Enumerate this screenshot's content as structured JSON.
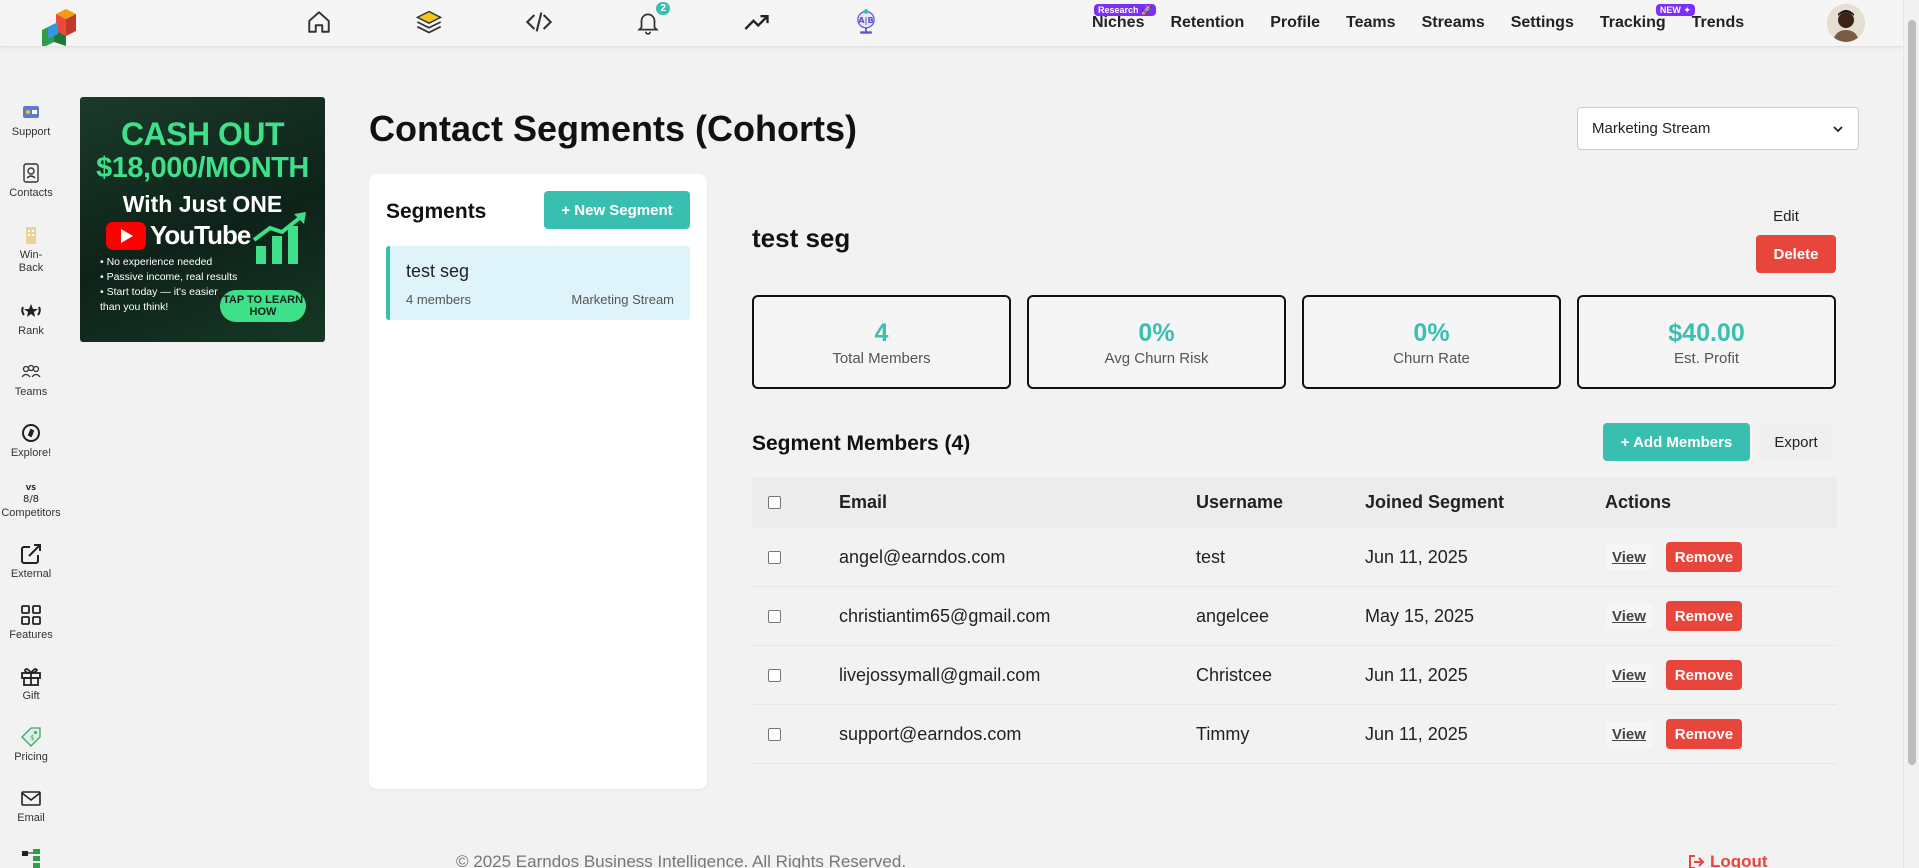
{
  "topbar": {
    "notification_count": "2",
    "nav": [
      {
        "label": "Niches",
        "badge": "Research 🚀"
      },
      {
        "label": "Retention"
      },
      {
        "label": "Profile"
      },
      {
        "label": "Teams"
      },
      {
        "label": "Streams"
      },
      {
        "label": "Settings"
      },
      {
        "label": "Tracking",
        "badge": "NEW ✦"
      },
      {
        "label": "Trends"
      }
    ]
  },
  "sidebar": {
    "items": [
      {
        "label": "Support",
        "icon": "support-icon"
      },
      {
        "label": "Contacts",
        "icon": "contacts-icon"
      },
      {
        "label": "Win-\nBack",
        "icon": "win-back-icon"
      },
      {
        "label": "Rank",
        "icon": "rank-icon"
      },
      {
        "label": "Teams",
        "icon": "teams-icon"
      },
      {
        "label": "Explore!",
        "icon": "compass-icon"
      },
      {
        "label": "Competitors",
        "icon": "vs-icon"
      },
      {
        "label": "External",
        "icon": "external-link-icon"
      },
      {
        "label": "Features",
        "icon": "grid-icon"
      },
      {
        "label": "Gift",
        "icon": "gift-icon"
      },
      {
        "label": "Pricing",
        "icon": "price-tag-icon"
      },
      {
        "label": "Email",
        "icon": "mail-icon"
      }
    ]
  },
  "ad": {
    "line1": "CASH OUT",
    "line2": "$18,000/MONTH",
    "line3": "With Just ONE",
    "youtube": "YouTube",
    "bullets": [
      "No experience needed",
      "Passive income, real results",
      "Start today — it's easier than you think!"
    ],
    "cta": "TAP TO LEARN HOW"
  },
  "page": {
    "title": "Contact Segments (Cohorts)",
    "stream_select": "Marketing Stream"
  },
  "segments": {
    "heading": "Segments",
    "new_button": "+ New Segment",
    "items": [
      {
        "name": "test seg",
        "members": "4 members",
        "stream": "Marketing Stream"
      }
    ]
  },
  "detail": {
    "title": "test seg",
    "edit": "Edit",
    "delete": "Delete",
    "stats": [
      {
        "value": "4",
        "label": "Total Members"
      },
      {
        "value": "0%",
        "label": "Avg Churn Risk"
      },
      {
        "value": "0%",
        "label": "Churn Rate"
      },
      {
        "value": "$40.00",
        "label": "Est. Profit"
      }
    ],
    "members_title": "Segment Members (4)",
    "add_members": "+ Add Members",
    "export": "Export"
  },
  "table": {
    "headers": {
      "email": "Email",
      "username": "Username",
      "joined": "Joined Segment",
      "actions": "Actions"
    },
    "rows": [
      {
        "email": "angel@earndos.com",
        "username": "test",
        "joined": "Jun 11, 2025"
      },
      {
        "email": "christiantim65@gmail.com",
        "username": "angelcee",
        "joined": "May 15, 2025"
      },
      {
        "email": "livejossymall@gmail.com",
        "username": "Christcee",
        "joined": "Jun 11, 2025"
      },
      {
        "email": "support@earndos.com",
        "username": "Timmy",
        "joined": "Jun 11, 2025"
      }
    ],
    "view_label": "View",
    "remove_label": "Remove"
  },
  "footer": {
    "copyright": "© 2025 Earndos Business Intelligence. All Rights Reserved.",
    "logout": "Logout"
  },
  "colors": {
    "accent": "#38bfb0",
    "danger": "#e8453c",
    "badge": "#7b2ff7"
  }
}
